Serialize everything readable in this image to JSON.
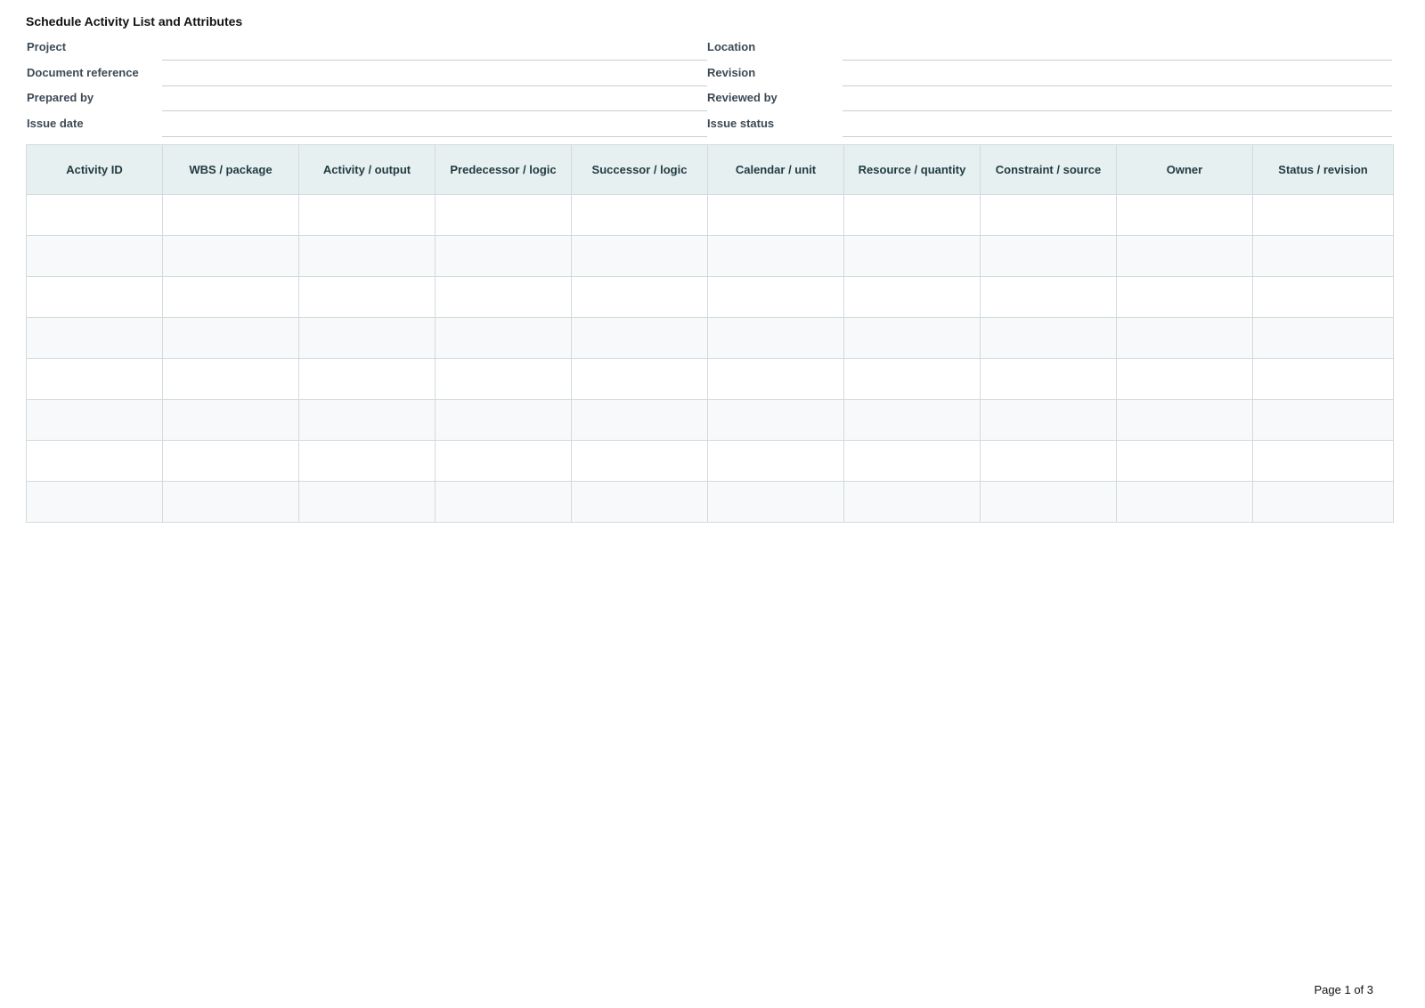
{
  "title": "Schedule Activity List and Attributes",
  "meta_fields": [
    {
      "left_label": "Project",
      "left_value": "",
      "right_label": "Location",
      "right_value": ""
    },
    {
      "left_label": "Document reference",
      "left_value": "",
      "right_label": "Revision",
      "right_value": ""
    },
    {
      "left_label": "Prepared by",
      "left_value": "",
      "right_label": "Reviewed by",
      "right_value": ""
    },
    {
      "left_label": "Issue date",
      "left_value": "",
      "right_label": "Issue status",
      "right_value": ""
    }
  ],
  "table": {
    "columns": [
      "Activity ID",
      "WBS / package",
      "Activity / output",
      "Predecessor / logic",
      "Successor / logic",
      "Calendar / unit",
      "Resource / quantity",
      "Constraint / source",
      "Owner",
      "Status / revision"
    ],
    "rows": [
      [
        "",
        "",
        "",
        "",
        "",
        "",
        "",
        "",
        "",
        ""
      ],
      [
        "",
        "",
        "",
        "",
        "",
        "",
        "",
        "",
        "",
        ""
      ],
      [
        "",
        "",
        "",
        "",
        "",
        "",
        "",
        "",
        "",
        ""
      ],
      [
        "",
        "",
        "",
        "",
        "",
        "",
        "",
        "",
        "",
        ""
      ],
      [
        "",
        "",
        "",
        "",
        "",
        "",
        "",
        "",
        "",
        ""
      ],
      [
        "",
        "",
        "",
        "",
        "",
        "",
        "",
        "",
        "",
        ""
      ],
      [
        "",
        "",
        "",
        "",
        "",
        "",
        "",
        "",
        "",
        ""
      ],
      [
        "",
        "",
        "",
        "",
        "",
        "",
        "",
        "",
        "",
        ""
      ]
    ]
  },
  "footer": {
    "page_indicator": "Page 1 of 3"
  }
}
